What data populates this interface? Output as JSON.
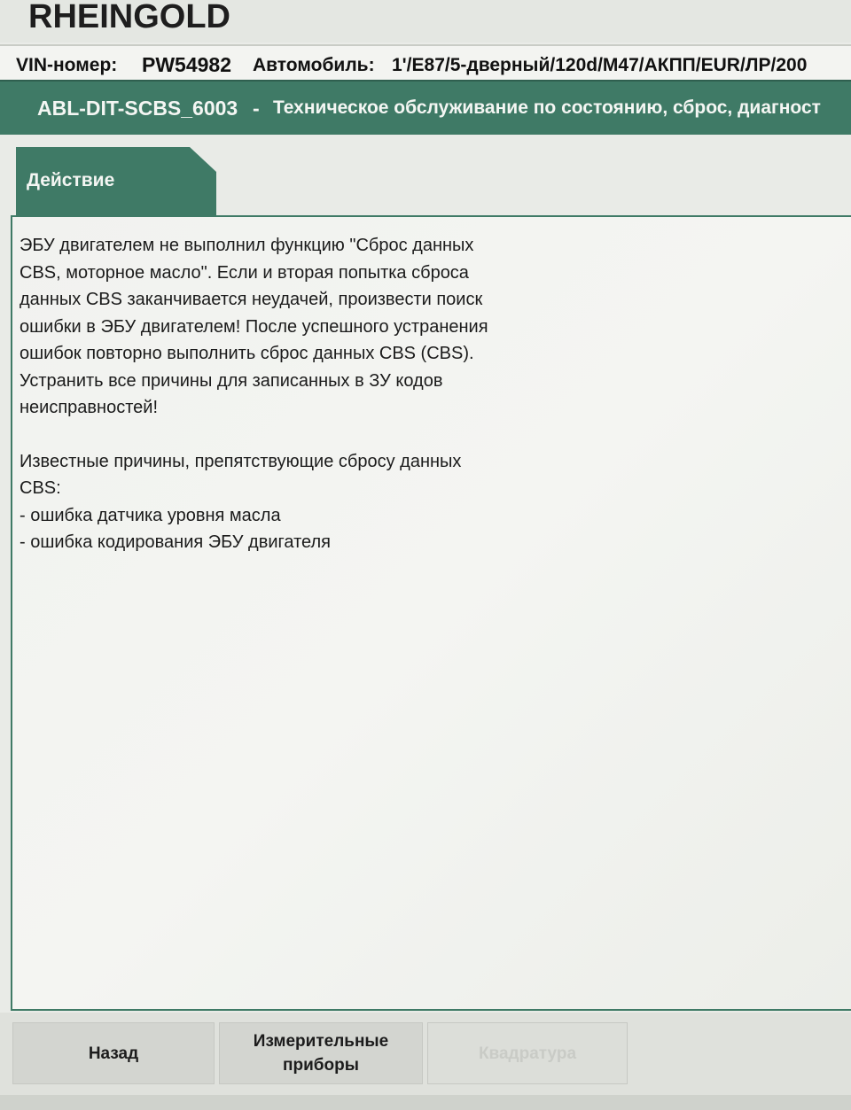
{
  "app": {
    "title": "RHEINGOLD"
  },
  "vehicle": {
    "vin_label": "VIN-номер:",
    "vin_value": "PW54982",
    "car_label": "Автомобиль:",
    "car_value": "1'/E87/5-дверный/120d/M47/АКПП/EUR/ЛР/200"
  },
  "procedure": {
    "code": "ABL-DIT-SCBS_6003",
    "separator": "-",
    "title": "Техническое обслуживание по состоянию, сброс, диагност"
  },
  "tab": {
    "label": "Действие"
  },
  "message": {
    "paragraph1": [
      "ЭБУ двигателем не выполнил функцию \"Сброс данных",
      "CBS, моторное масло\". Если и вторая попытка сброса",
      "данных CBS заканчивается неудачей, произвести поиск",
      "ошибки в ЭБУ двигателем! После успешного устранения",
      "ошибок повторно выполнить сброс данных CBS (CBS).",
      "Устранить все причины для записанных в ЗУ кодов",
      "неисправностей!"
    ],
    "paragraph2": [
      "Известные причины, препятствующие сбросу данных",
      "CBS:",
      "- ошибка датчика уровня масла",
      "- ошибка кодирования ЭБУ двигателя"
    ]
  },
  "buttons": {
    "back": "Назад",
    "measure_line1": "Измерительные",
    "measure_line2": "приборы",
    "disabled": "Квадратура"
  }
}
